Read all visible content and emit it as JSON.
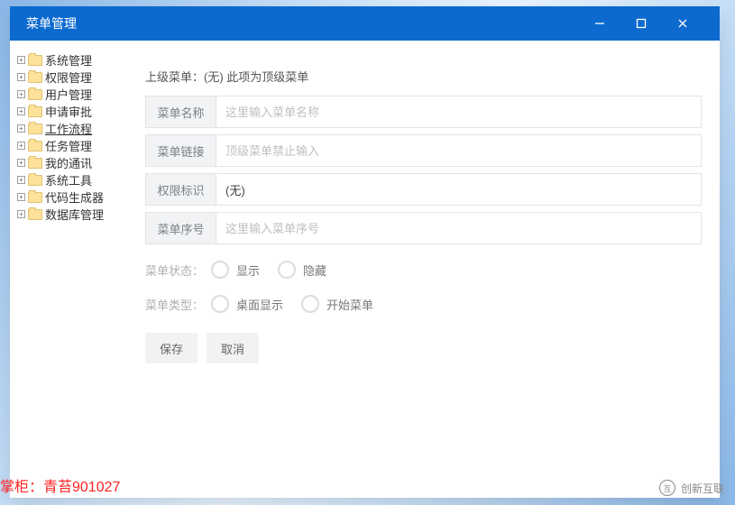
{
  "window": {
    "title": "菜单管理"
  },
  "tree": {
    "items": [
      {
        "label": "系统管理",
        "underline": false
      },
      {
        "label": "权限管理",
        "underline": false
      },
      {
        "label": "用户管理",
        "underline": false
      },
      {
        "label": "申请审批",
        "underline": false
      },
      {
        "label": "工作流程",
        "underline": true
      },
      {
        "label": "任务管理",
        "underline": false
      },
      {
        "label": "我的通讯",
        "underline": false
      },
      {
        "label": "系统工具",
        "underline": false
      },
      {
        "label": "代码生成器",
        "underline": false
      },
      {
        "label": "数据库管理",
        "underline": false
      }
    ]
  },
  "form": {
    "breadcrumb": "上级菜单：(无) 此项为顶级菜单",
    "fields": {
      "name": {
        "label": "菜单名称",
        "value": "",
        "placeholder": "这里输入菜单名称"
      },
      "link": {
        "label": "菜单链接",
        "value": "",
        "placeholder": "顶级菜单禁止输入"
      },
      "perm": {
        "label": "权限标识",
        "value": "(无)",
        "placeholder": ""
      },
      "order": {
        "label": "菜单序号",
        "value": "",
        "placeholder": "这里输入菜单序号"
      }
    },
    "status": {
      "label": "菜单状态：",
      "opt_show": "显示",
      "opt_hide": "隐藏"
    },
    "type": {
      "label": "菜单类型：",
      "opt_desktop": "桌面显示",
      "opt_start": "开始菜单"
    },
    "buttons": {
      "save": "保存",
      "cancel": "取消"
    }
  },
  "footer": "掌柜：青苔901027",
  "watermark": "创新互联"
}
